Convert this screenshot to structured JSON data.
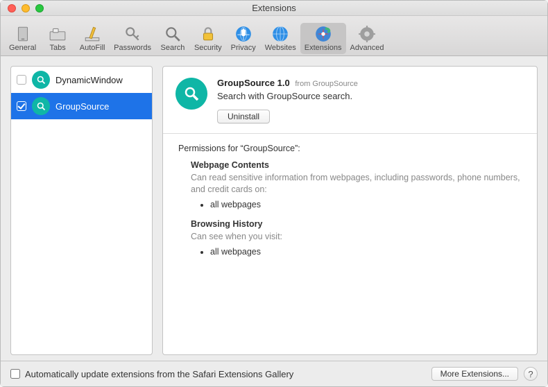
{
  "window": {
    "title": "Extensions"
  },
  "toolbar": {
    "items": [
      {
        "label": "General"
      },
      {
        "label": "Tabs"
      },
      {
        "label": "AutoFill"
      },
      {
        "label": "Passwords"
      },
      {
        "label": "Search"
      },
      {
        "label": "Security"
      },
      {
        "label": "Privacy"
      },
      {
        "label": "Websites"
      },
      {
        "label": "Extensions"
      },
      {
        "label": "Advanced"
      }
    ],
    "active_index": 8
  },
  "sidebar": {
    "extensions": [
      {
        "name": "DynamicWindow",
        "checked": false,
        "selected": false
      },
      {
        "name": "GroupSource",
        "checked": true,
        "selected": true
      }
    ]
  },
  "detail": {
    "title_name": "GroupSource 1.0",
    "from_label": "from GroupSource",
    "description": "Search with GroupSource search.",
    "uninstall_label": "Uninstall",
    "permissions_header": "Permissions for “GroupSource”:",
    "permissions": [
      {
        "heading": "Webpage Contents",
        "desc": "Can read sensitive information from webpages, including passwords, phone numbers, and credit cards on:",
        "items": [
          "all webpages"
        ]
      },
      {
        "heading": "Browsing History",
        "desc": "Can see when you visit:",
        "items": [
          "all webpages"
        ]
      }
    ]
  },
  "footer": {
    "auto_update_label": "Automatically update extensions from the Safari Extensions Gallery",
    "auto_update_checked": false,
    "more_label": "More Extensions...",
    "help_label": "?"
  }
}
